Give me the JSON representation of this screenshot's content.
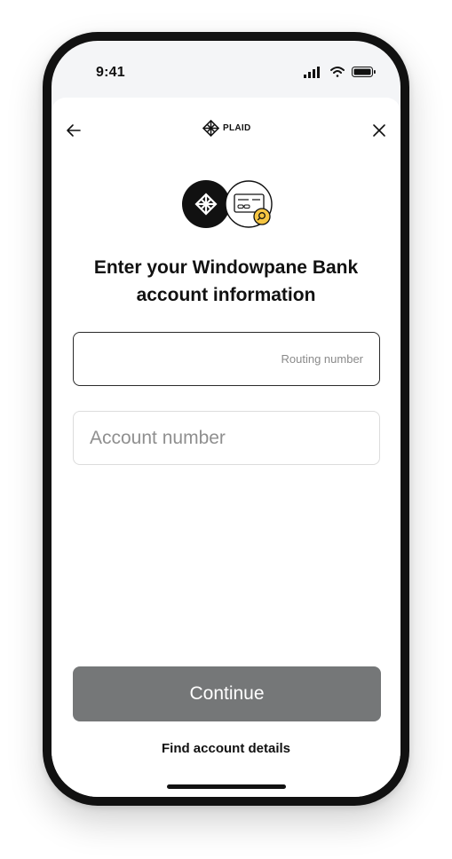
{
  "status_bar": {
    "time": "9:41"
  },
  "header": {
    "brand": "PLAID"
  },
  "title": "Enter your Windowpane Bank account information",
  "fields": {
    "routing": {
      "label": "Routing number",
      "value": ""
    },
    "account": {
      "placeholder": "Account number",
      "value": ""
    }
  },
  "actions": {
    "continue_label": "Continue",
    "find_details_label": "Find account details"
  },
  "icons": [
    "back-arrow-icon",
    "plaid-logo-icon",
    "close-icon",
    "check-icon",
    "magnifier-icon",
    "signal-icon",
    "wifi-icon",
    "battery-icon"
  ],
  "colors": {
    "button_disabled": "#757778",
    "accent_yellow": "#f5c542",
    "text": "#111111"
  }
}
